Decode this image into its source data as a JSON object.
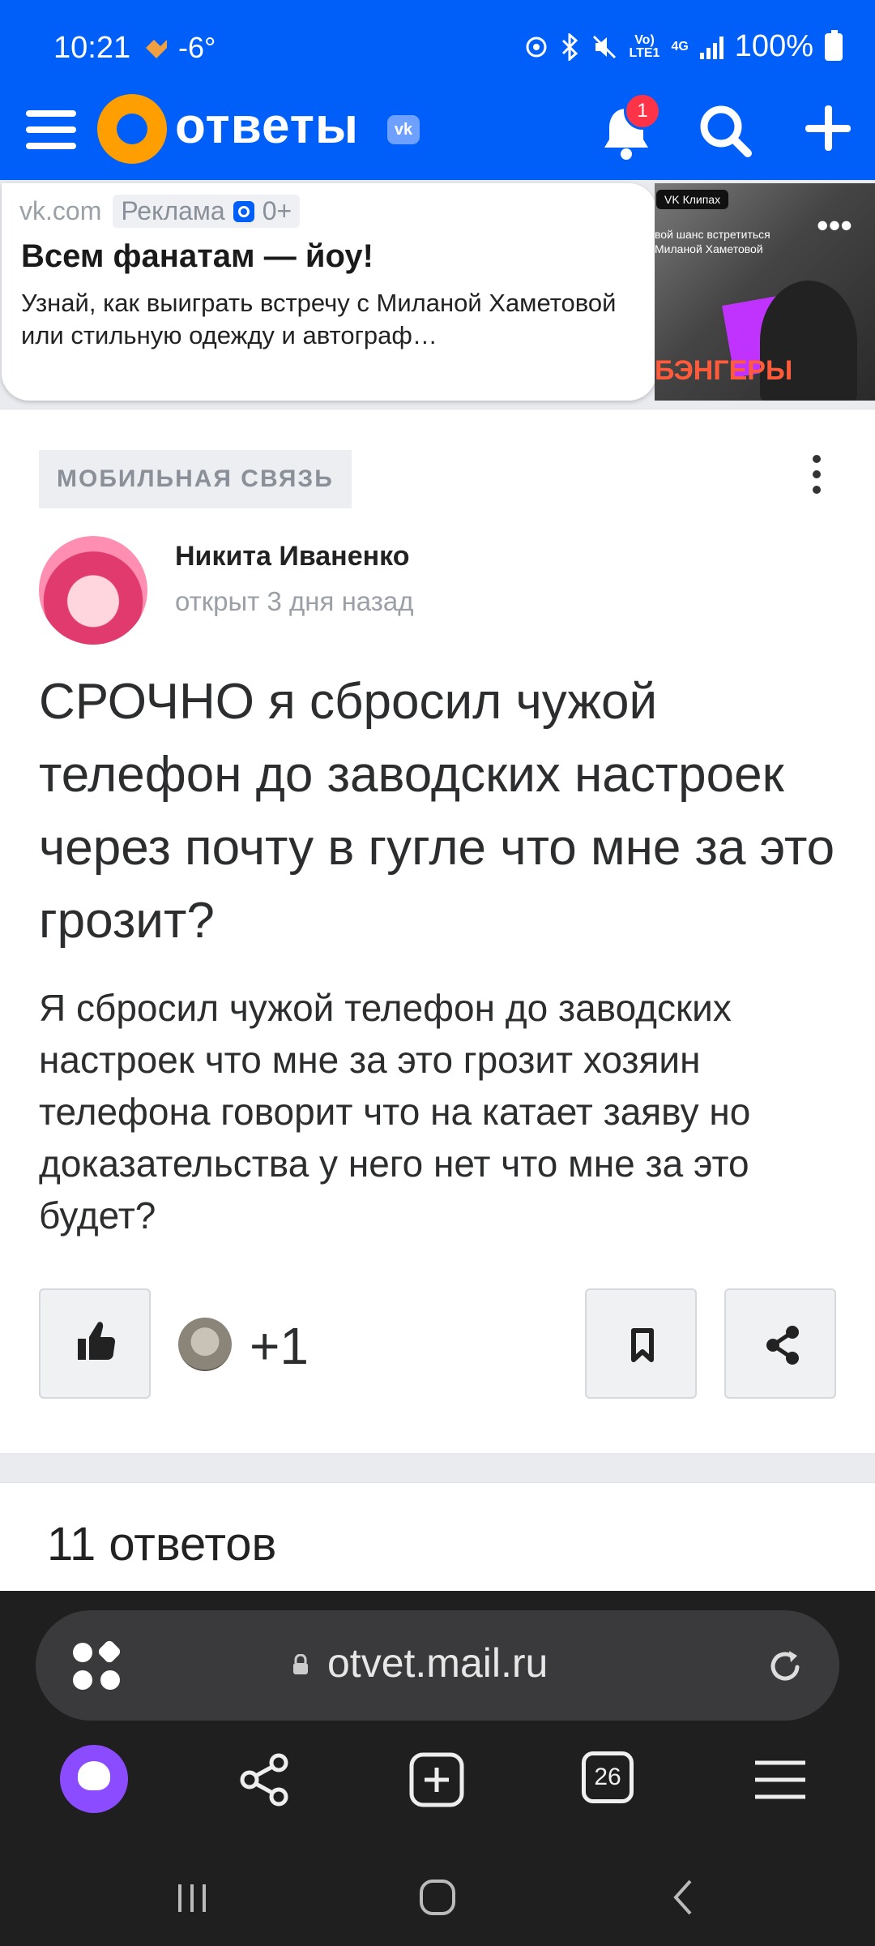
{
  "status_bar": {
    "time": "10:21",
    "weather": "-6°",
    "net_top": "Vo)",
    "net_bottom": "LTE1",
    "net_type": "4G",
    "battery": "100%"
  },
  "header": {
    "logo_text": "ответы",
    "vk_badge": "vk",
    "notification_count": "1",
    "accent_color": "#005ff9",
    "logo_color": "#ff9e00"
  },
  "ad": {
    "domain": "vk.com",
    "label": "Реклама",
    "age_rating": "0+",
    "title": "Всем фанатам — йоу!",
    "text": "Узнай, как выиграть встречу с Миланой Хаметовой или стильную одежду и автограф…",
    "image_pill": "VK Клипах",
    "image_caption": "вой шанс встретиться Миланой Хаметовой",
    "image_brand": "БЭНГЕРЫ",
    "menu_dots": "•••"
  },
  "question": {
    "category": "МОБИЛЬНАЯ СВЯЗЬ",
    "author": "Никита Иваненко",
    "opened": "открыт 3 дня назад",
    "title": "СРОЧНО я сбросил чужой телефон до заводских настроек через почту в гугле что мне за это грозит?",
    "body": "Я сбросил чужой телефон до заводских настроек что мне за это грозит хозяин телефона говорит что на катает заяву но доказательства у него нет что мне за это будет?",
    "likers_count": "+1"
  },
  "answers": {
    "title": "11 ответов"
  },
  "browser": {
    "url": "otvet.mail.ru",
    "tab_count": "26"
  }
}
